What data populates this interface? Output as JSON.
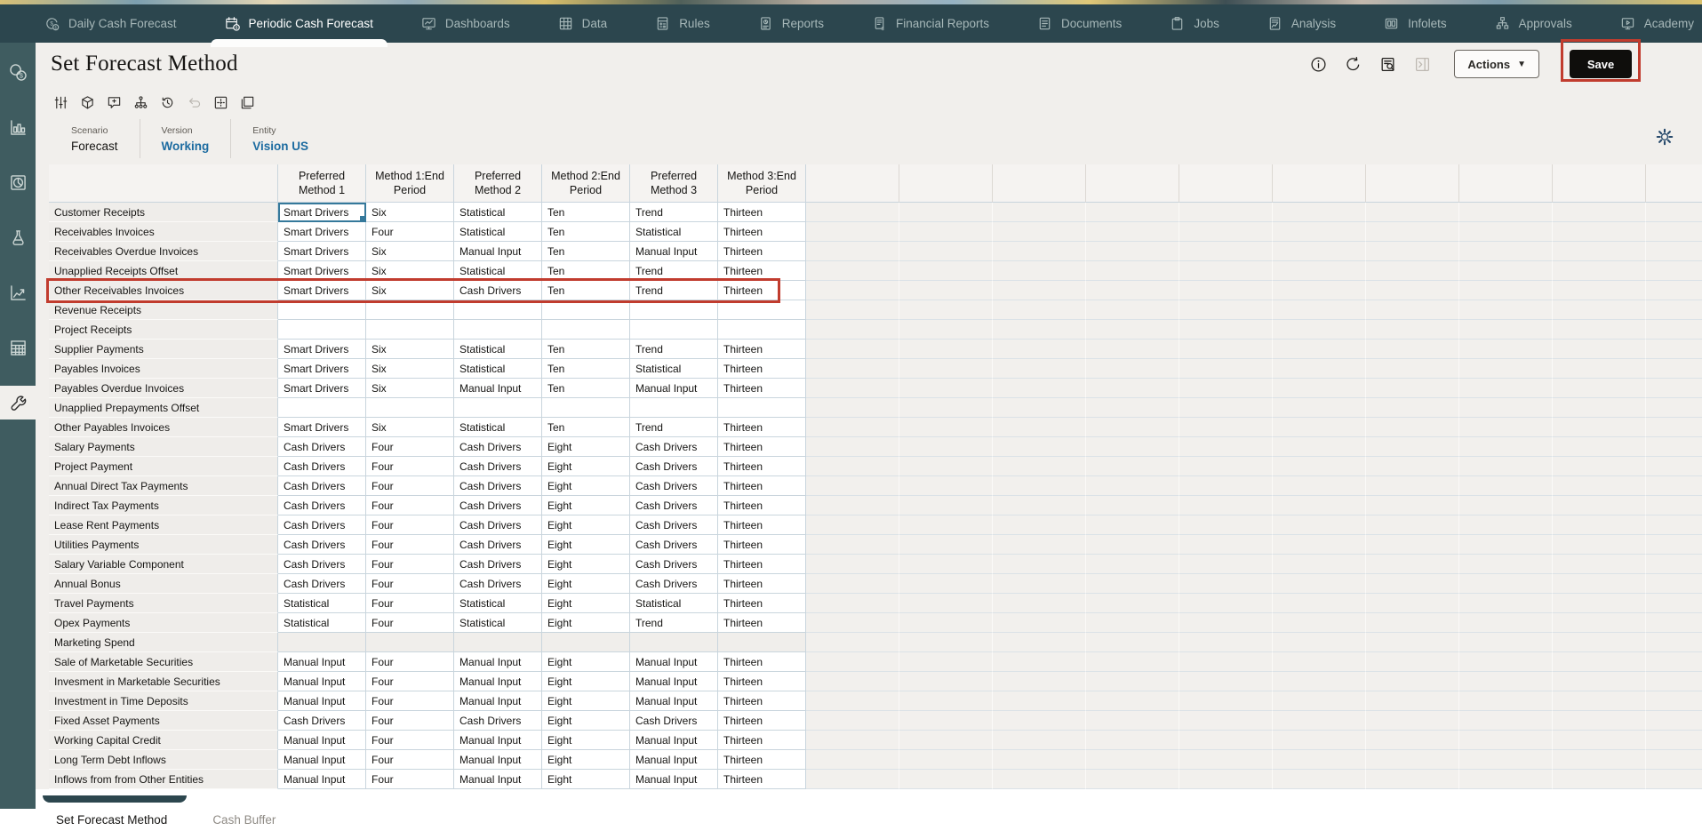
{
  "nav": {
    "tabs": [
      {
        "label": "Daily Cash Forecast",
        "icon": "clock-dollar-icon",
        "active": false
      },
      {
        "label": "Periodic Cash Forecast",
        "icon": "calendar-cash-icon",
        "active": true
      },
      {
        "label": "Dashboards",
        "icon": "dashboard-icon",
        "active": false
      },
      {
        "label": "Data",
        "icon": "data-grid-icon",
        "active": false
      },
      {
        "label": "Rules",
        "icon": "calculator-icon",
        "active": false
      },
      {
        "label": "Reports",
        "icon": "report-icon",
        "active": false
      },
      {
        "label": "Financial Reports",
        "icon": "financial-report-icon",
        "active": false
      },
      {
        "label": "Documents",
        "icon": "document-icon",
        "active": false
      },
      {
        "label": "Jobs",
        "icon": "jobs-icon",
        "active": false
      },
      {
        "label": "Analysis",
        "icon": "analysis-icon",
        "active": false
      },
      {
        "label": "Infolets",
        "icon": "infolets-icon",
        "active": false
      },
      {
        "label": "Approvals",
        "icon": "approvals-icon",
        "active": false
      },
      {
        "label": "Academy",
        "icon": "academy-icon",
        "active": false
      }
    ]
  },
  "sidebar": {
    "items": [
      {
        "icon": "coins-icon",
        "active": false
      },
      {
        "icon": "bar-chart-icon",
        "active": false
      },
      {
        "icon": "pie-chart-icon",
        "active": false
      },
      {
        "icon": "flask-icon",
        "active": false
      },
      {
        "icon": "trend-chart-icon",
        "active": false
      },
      {
        "icon": "table-icon",
        "active": false
      },
      {
        "icon": "wrench-icon",
        "active": true
      }
    ]
  },
  "page": {
    "title": "Set Forecast Method"
  },
  "header_actions": {
    "icons": [
      {
        "name": "info-icon",
        "disabled": false
      },
      {
        "name": "refresh-icon",
        "disabled": false
      },
      {
        "name": "query-list-icon",
        "disabled": false
      },
      {
        "name": "collapse-panel-icon",
        "disabled": true
      }
    ],
    "actions_label": "Actions",
    "save_label": "Save"
  },
  "toolbar": {
    "icons": [
      {
        "name": "adjust-sliders-icon",
        "disabled": false
      },
      {
        "name": "cube-icon",
        "disabled": false
      },
      {
        "name": "comment-add-icon",
        "disabled": false
      },
      {
        "name": "hierarchy-icon",
        "disabled": false
      },
      {
        "name": "history-icon",
        "disabled": false
      },
      {
        "name": "undo-icon",
        "disabled": true
      },
      {
        "name": "grid-options-icon",
        "disabled": false
      },
      {
        "name": "window-layout-icon",
        "disabled": false
      }
    ]
  },
  "pov": {
    "items": [
      {
        "label": "Scenario",
        "value": "Forecast",
        "link": false
      },
      {
        "label": "Version",
        "value": "Working",
        "link": true
      },
      {
        "label": "Entity",
        "value": "Vision US",
        "link": true
      }
    ],
    "gear_icon": "gear-icon"
  },
  "grid": {
    "columns": [
      "Preferred Method 1",
      "Method 1:End Period",
      "Preferred Method 2",
      "Method 2:End Period",
      "Preferred Method 3",
      "Method 3:End Period"
    ],
    "selected_cell": {
      "row": 0,
      "col": 0
    },
    "highlighted_row_index": 4,
    "rows": [
      {
        "label": "Customer Receipts",
        "cells": [
          "Smart Drivers",
          "Six",
          "Statistical",
          "Ten",
          "Trend",
          "Thirteen"
        ],
        "shaded": false
      },
      {
        "label": "Receivables Invoices",
        "cells": [
          "Smart Drivers",
          "Four",
          "Statistical",
          "Ten",
          "Statistical",
          "Thirteen"
        ],
        "shaded": false
      },
      {
        "label": "Receivables Overdue Invoices",
        "cells": [
          "Smart Drivers",
          "Six",
          "Manual Input",
          "Ten",
          "Manual Input",
          "Thirteen"
        ],
        "shaded": false
      },
      {
        "label": "Unapplied Receipts Offset",
        "cells": [
          "Smart Drivers",
          "Six",
          "Statistical",
          "Ten",
          "Trend",
          "Thirteen"
        ],
        "shaded": false
      },
      {
        "label": "Other Receivables Invoices",
        "cells": [
          "Smart Drivers",
          "Six",
          "Cash Drivers",
          "Ten",
          "Trend",
          "Thirteen"
        ],
        "shaded": false
      },
      {
        "label": "Revenue Receipts",
        "cells": [
          "",
          "",
          "",
          "",
          "",
          ""
        ],
        "shaded": false
      },
      {
        "label": "Project Receipts",
        "cells": [
          "",
          "",
          "",
          "",
          "",
          ""
        ],
        "shaded": false
      },
      {
        "label": "Supplier Payments",
        "cells": [
          "Smart Drivers",
          "Six",
          "Statistical",
          "Ten",
          "Trend",
          "Thirteen"
        ],
        "shaded": false
      },
      {
        "label": "Payables Invoices",
        "cells": [
          "Smart Drivers",
          "Six",
          "Statistical",
          "Ten",
          "Statistical",
          "Thirteen"
        ],
        "shaded": false
      },
      {
        "label": "Payables Overdue Invoices",
        "cells": [
          "Smart Drivers",
          "Six",
          "Manual Input",
          "Ten",
          "Manual Input",
          "Thirteen"
        ],
        "shaded": false
      },
      {
        "label": "Unapplied Prepayments Offset",
        "cells": [
          "",
          "",
          "",
          "",
          "",
          ""
        ],
        "shaded": false
      },
      {
        "label": "Other Payables Invoices",
        "cells": [
          "Smart Drivers",
          "Six",
          "Statistical",
          "Ten",
          "Trend",
          "Thirteen"
        ],
        "shaded": false
      },
      {
        "label": "Salary Payments",
        "cells": [
          "Cash Drivers",
          "Four",
          "Cash Drivers",
          "Eight",
          "Cash Drivers",
          "Thirteen"
        ],
        "shaded": false
      },
      {
        "label": "Project Payment",
        "cells": [
          "Cash Drivers",
          "Four",
          "Cash Drivers",
          "Eight",
          "Cash Drivers",
          "Thirteen"
        ],
        "shaded": false
      },
      {
        "label": "Annual Direct Tax Payments",
        "cells": [
          "Cash Drivers",
          "Four",
          "Cash Drivers",
          "Eight",
          "Cash Drivers",
          "Thirteen"
        ],
        "shaded": false
      },
      {
        "label": "Indirect Tax Payments",
        "cells": [
          "Cash Drivers",
          "Four",
          "Cash Drivers",
          "Eight",
          "Cash Drivers",
          "Thirteen"
        ],
        "shaded": false
      },
      {
        "label": "Lease Rent Payments",
        "cells": [
          "Cash Drivers",
          "Four",
          "Cash Drivers",
          "Eight",
          "Cash Drivers",
          "Thirteen"
        ],
        "shaded": false
      },
      {
        "label": "Utilities Payments",
        "cells": [
          "Cash Drivers",
          "Four",
          "Cash Drivers",
          "Eight",
          "Cash Drivers",
          "Thirteen"
        ],
        "shaded": false
      },
      {
        "label": "Salary Variable Component",
        "cells": [
          "Cash Drivers",
          "Four",
          "Cash Drivers",
          "Eight",
          "Cash Drivers",
          "Thirteen"
        ],
        "shaded": false
      },
      {
        "label": "Annual Bonus",
        "cells": [
          "Cash Drivers",
          "Four",
          "Cash Drivers",
          "Eight",
          "Cash Drivers",
          "Thirteen"
        ],
        "shaded": false
      },
      {
        "label": "Travel Payments",
        "cells": [
          "Statistical",
          "Four",
          "Statistical",
          "Eight",
          "Statistical",
          "Thirteen"
        ],
        "shaded": false
      },
      {
        "label": "Opex Payments",
        "cells": [
          "Statistical",
          "Four",
          "Statistical",
          "Eight",
          "Trend",
          "Thirteen"
        ],
        "shaded": false
      },
      {
        "label": "Marketing Spend",
        "cells": [
          "",
          "",
          "",
          "",
          "",
          ""
        ],
        "shaded": true
      },
      {
        "label": "Sale of Marketable Securities",
        "cells": [
          "Manual Input",
          "Four",
          "Manual Input",
          "Eight",
          "Manual Input",
          "Thirteen"
        ],
        "shaded": false
      },
      {
        "label": "Invesment in Marketable Securities",
        "cells": [
          "Manual Input",
          "Four",
          "Manual Input",
          "Eight",
          "Manual Input",
          "Thirteen"
        ],
        "shaded": false
      },
      {
        "label": "Investment in Time Deposits",
        "cells": [
          "Manual Input",
          "Four",
          "Manual Input",
          "Eight",
          "Manual Input",
          "Thirteen"
        ],
        "shaded": false
      },
      {
        "label": "Fixed Asset Payments",
        "cells": [
          "Cash Drivers",
          "Four",
          "Cash Drivers",
          "Eight",
          "Cash Drivers",
          "Thirteen"
        ],
        "shaded": false
      },
      {
        "label": "Working Capital Credit",
        "cells": [
          "Manual Input",
          "Four",
          "Manual Input",
          "Eight",
          "Manual Input",
          "Thirteen"
        ],
        "shaded": false
      },
      {
        "label": "Long Term Debt Inflows",
        "cells": [
          "Manual Input",
          "Four",
          "Manual Input",
          "Eight",
          "Manual Input",
          "Thirteen"
        ],
        "shaded": false
      },
      {
        "label": "Inflows from from Other Entities",
        "cells": [
          "Manual Input",
          "Four",
          "Manual Input",
          "Eight",
          "Manual Input",
          "Thirteen"
        ],
        "shaded": false
      }
    ]
  },
  "bottom_tabs": [
    {
      "label": "Set Forecast Method",
      "active": true
    },
    {
      "label": "Cash Buffer",
      "active": false
    }
  ],
  "annotations": {
    "highlight_color": "#c13c2e",
    "highlighted_row": "Other Receivables Invoices",
    "highlighted_button": "Save"
  },
  "colors": {
    "nav_background": "#2c464e",
    "sidebar_background": "#3f5c60",
    "content_background": "#f1efec",
    "link_blue": "#1c6ba0",
    "selected_cell_border": "#35799b",
    "save_button_background": "#0f0e0c",
    "annotation_red": "#c13c2e"
  }
}
